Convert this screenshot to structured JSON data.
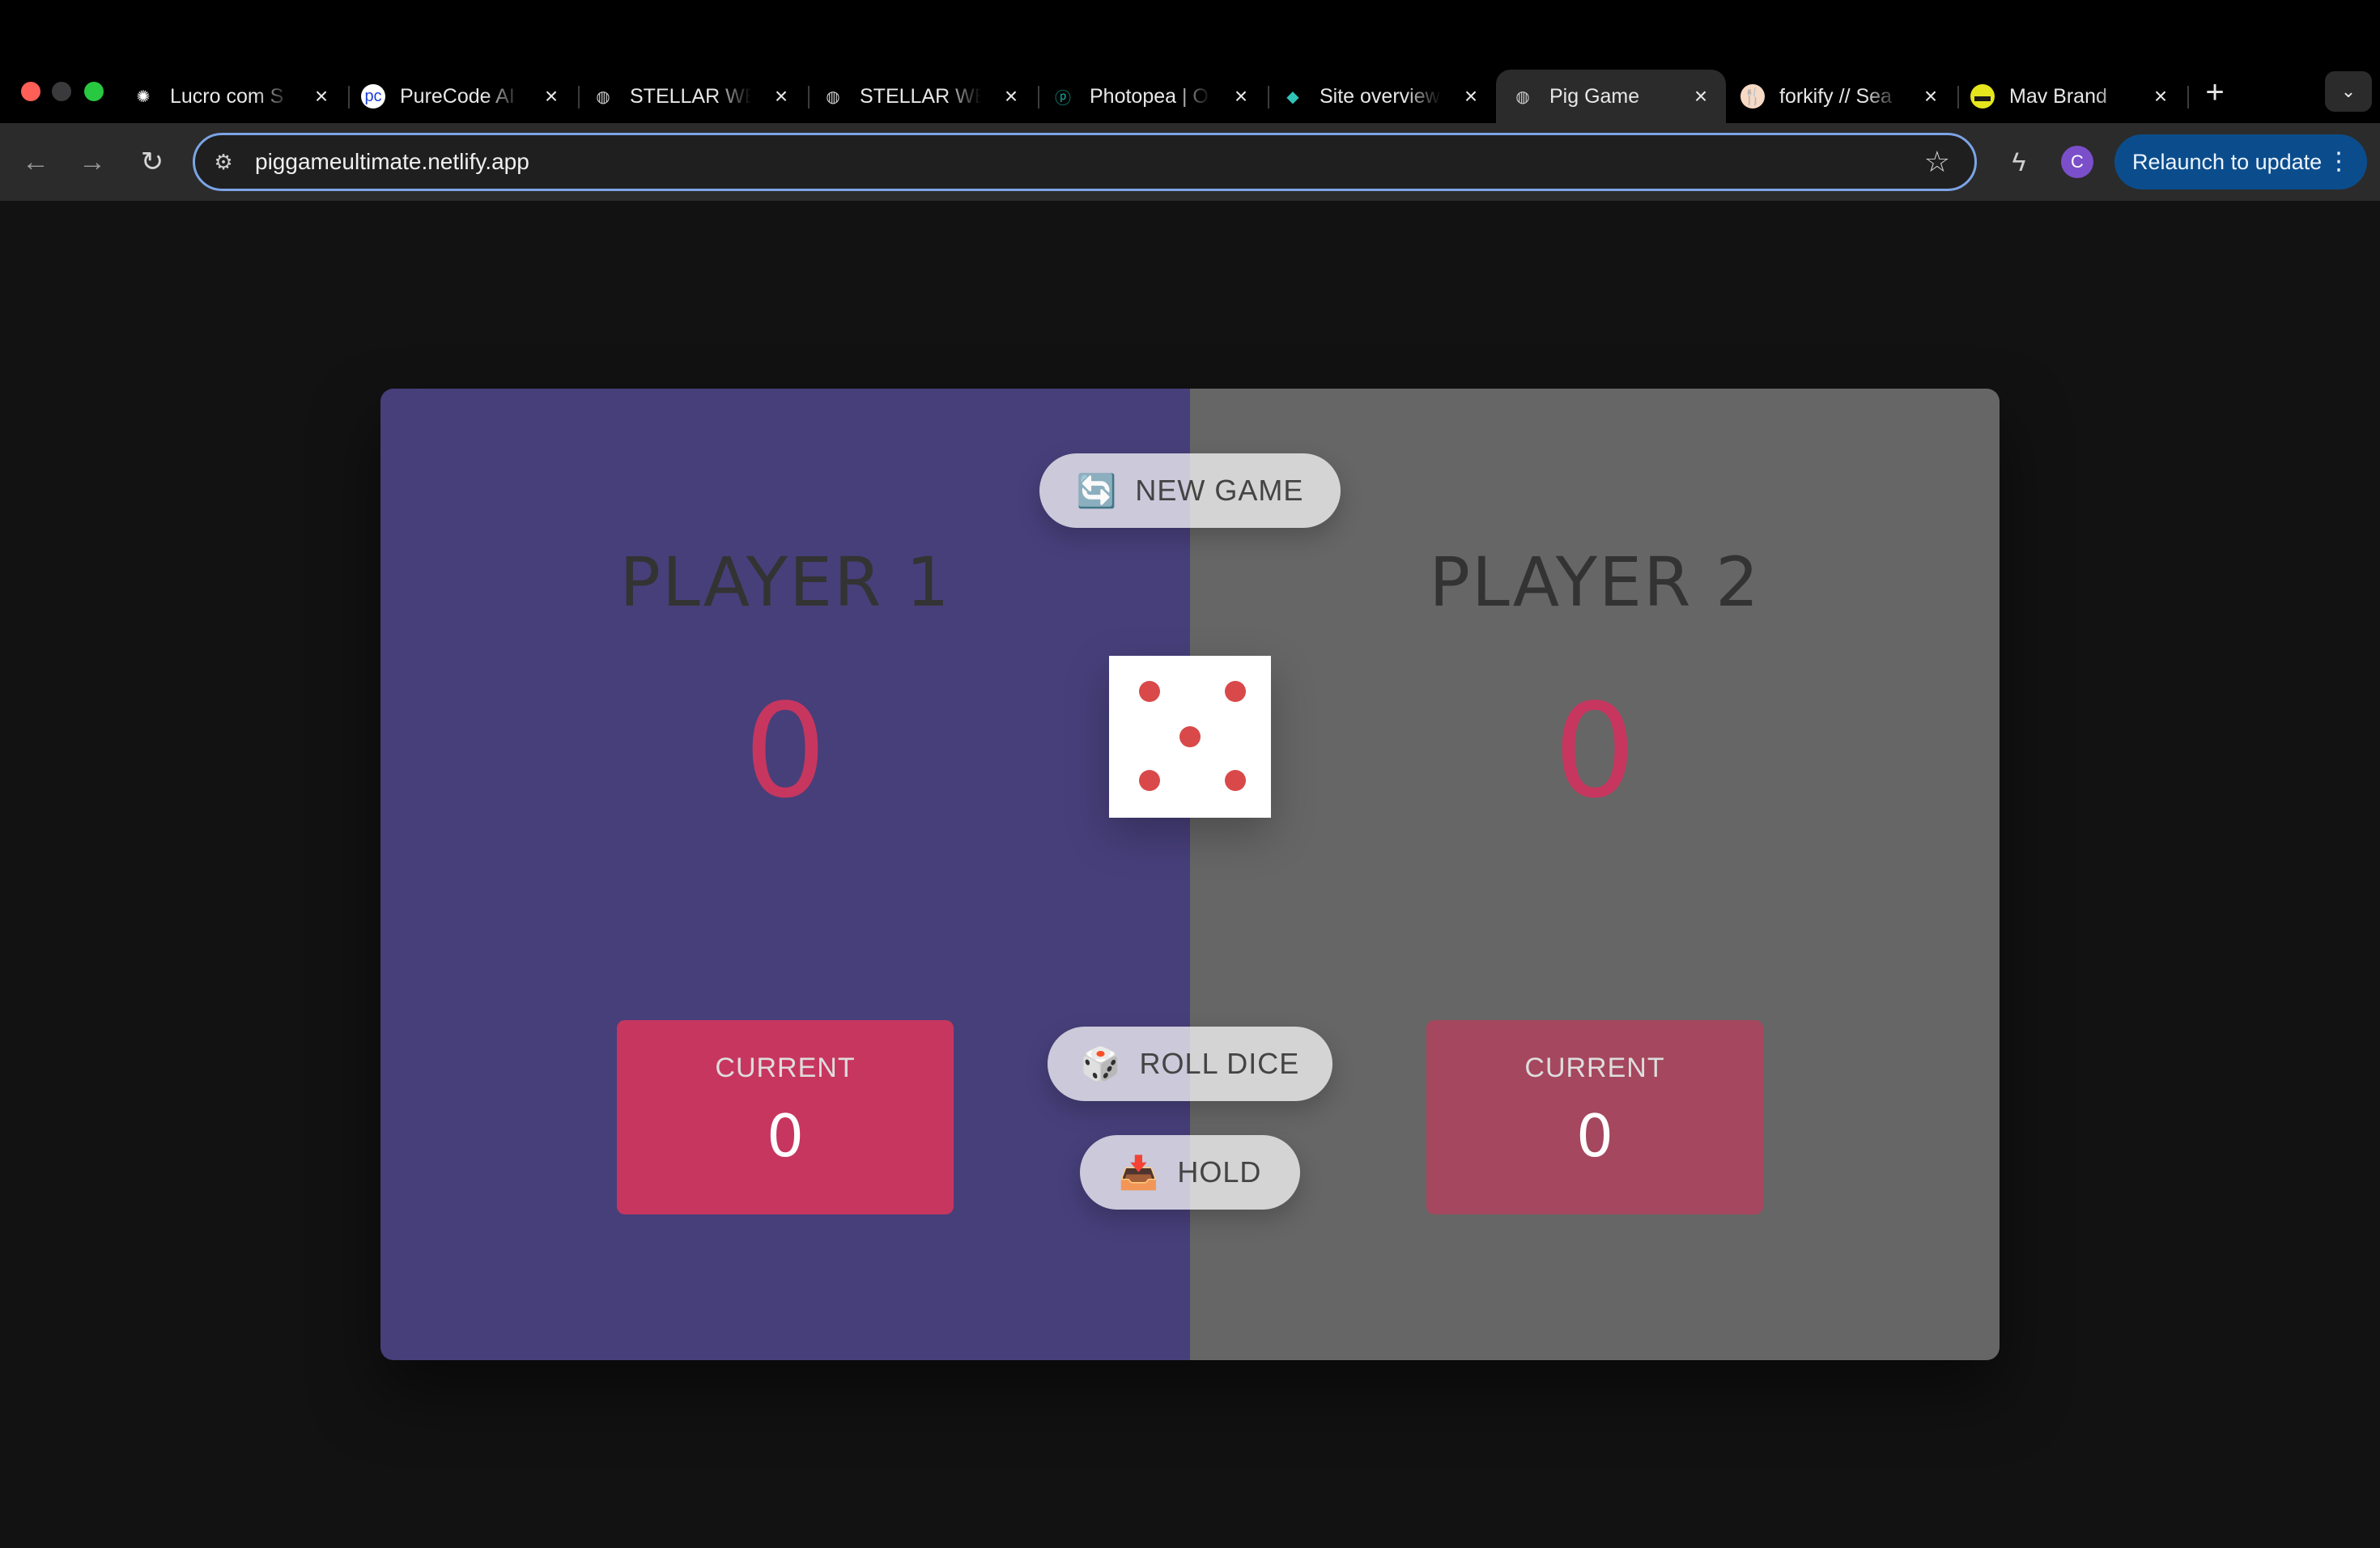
{
  "browser": {
    "tabs": [
      {
        "title": "Lucro com S",
        "icon": "openai-icon",
        "fav": "✺",
        "fav_color": "#ffffff",
        "fav_bg": "transparent"
      },
      {
        "title": "PureCode AI",
        "icon": "purecode-icon",
        "fav": "pc",
        "fav_color": "#1a3fd6",
        "fav_bg": "#ffffff"
      },
      {
        "title": "STELLAR WE",
        "icon": "globe-icon",
        "fav": "◍",
        "fav_color": "#cfcfcf",
        "fav_bg": "transparent"
      },
      {
        "title": "STELLAR WE",
        "icon": "globe-icon",
        "fav": "◍",
        "fav_color": "#cfcfcf",
        "fav_bg": "transparent"
      },
      {
        "title": "Photopea | O",
        "icon": "photopea-icon",
        "fav": "ⓟ",
        "fav_color": "#18a497",
        "fav_bg": "transparent"
      },
      {
        "title": "Site overview",
        "icon": "netlify-icon",
        "fav": "◆",
        "fav_color": "#32c3b8",
        "fav_bg": "transparent"
      },
      {
        "title": "Pig Game",
        "icon": "globe-icon",
        "fav": "◍",
        "fav_color": "#cfcfcf",
        "fav_bg": "transparent",
        "active": true
      },
      {
        "title": "forkify // Sea",
        "icon": "forkify-icon",
        "fav": "🍴",
        "fav_color": "#f38e82",
        "fav_bg": "#f7d9c4"
      },
      {
        "title": "Mav Brand",
        "icon": "mav-icon",
        "fav": "▬",
        "fav_color": "#1a1a1a",
        "fav_bg": "#e6e61e"
      }
    ],
    "url": "piggameultimate.netlify.app",
    "avatar_letter": "C",
    "relaunch_label": "Relaunch to update"
  },
  "game": {
    "new_game_label": "NEW GAME",
    "roll_dice_label": "ROLL DICE",
    "hold_label": "HOLD",
    "new_game_emoji": "🔄",
    "roll_dice_emoji": "🎲",
    "hold_emoji": "📥",
    "dice_value": 5,
    "players": [
      {
        "name": "PLAYER 1",
        "score": "0",
        "current_label": "CURRENT",
        "current_score": "0",
        "active": true
      },
      {
        "name": "PLAYER 2",
        "score": "0",
        "current_label": "CURRENT",
        "current_score": "0",
        "active": false
      }
    ]
  },
  "colors": {
    "player1_bg": "#473f7a",
    "player2_bg": "#666666",
    "score": "#c7365f",
    "pip": "#d9494a",
    "relaunch_bg": "#0b4d8c"
  }
}
